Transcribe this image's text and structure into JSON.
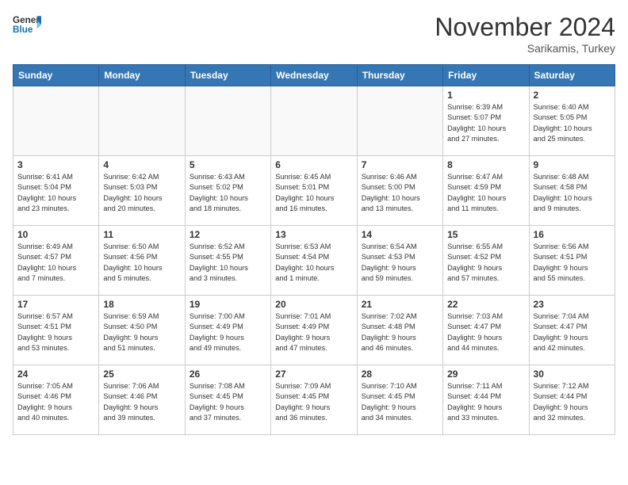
{
  "header": {
    "logo_line1": "General",
    "logo_line2": "Blue",
    "month": "November 2024",
    "location": "Sarikamis, Turkey"
  },
  "weekdays": [
    "Sunday",
    "Monday",
    "Tuesday",
    "Wednesday",
    "Thursday",
    "Friday",
    "Saturday"
  ],
  "weeks": [
    [
      {
        "day": "",
        "info": ""
      },
      {
        "day": "",
        "info": ""
      },
      {
        "day": "",
        "info": ""
      },
      {
        "day": "",
        "info": ""
      },
      {
        "day": "",
        "info": ""
      },
      {
        "day": "1",
        "info": "Sunrise: 6:39 AM\nSunset: 5:07 PM\nDaylight: 10 hours\nand 27 minutes."
      },
      {
        "day": "2",
        "info": "Sunrise: 6:40 AM\nSunset: 5:05 PM\nDaylight: 10 hours\nand 25 minutes."
      }
    ],
    [
      {
        "day": "3",
        "info": "Sunrise: 6:41 AM\nSunset: 5:04 PM\nDaylight: 10 hours\nand 23 minutes."
      },
      {
        "day": "4",
        "info": "Sunrise: 6:42 AM\nSunset: 5:03 PM\nDaylight: 10 hours\nand 20 minutes."
      },
      {
        "day": "5",
        "info": "Sunrise: 6:43 AM\nSunset: 5:02 PM\nDaylight: 10 hours\nand 18 minutes."
      },
      {
        "day": "6",
        "info": "Sunrise: 6:45 AM\nSunset: 5:01 PM\nDaylight: 10 hours\nand 16 minutes."
      },
      {
        "day": "7",
        "info": "Sunrise: 6:46 AM\nSunset: 5:00 PM\nDaylight: 10 hours\nand 13 minutes."
      },
      {
        "day": "8",
        "info": "Sunrise: 6:47 AM\nSunset: 4:59 PM\nDaylight: 10 hours\nand 11 minutes."
      },
      {
        "day": "9",
        "info": "Sunrise: 6:48 AM\nSunset: 4:58 PM\nDaylight: 10 hours\nand 9 minutes."
      }
    ],
    [
      {
        "day": "10",
        "info": "Sunrise: 6:49 AM\nSunset: 4:57 PM\nDaylight: 10 hours\nand 7 minutes."
      },
      {
        "day": "11",
        "info": "Sunrise: 6:50 AM\nSunset: 4:56 PM\nDaylight: 10 hours\nand 5 minutes."
      },
      {
        "day": "12",
        "info": "Sunrise: 6:52 AM\nSunset: 4:55 PM\nDaylight: 10 hours\nand 3 minutes."
      },
      {
        "day": "13",
        "info": "Sunrise: 6:53 AM\nSunset: 4:54 PM\nDaylight: 10 hours\nand 1 minute."
      },
      {
        "day": "14",
        "info": "Sunrise: 6:54 AM\nSunset: 4:53 PM\nDaylight: 9 hours\nand 59 minutes."
      },
      {
        "day": "15",
        "info": "Sunrise: 6:55 AM\nSunset: 4:52 PM\nDaylight: 9 hours\nand 57 minutes."
      },
      {
        "day": "16",
        "info": "Sunrise: 6:56 AM\nSunset: 4:51 PM\nDaylight: 9 hours\nand 55 minutes."
      }
    ],
    [
      {
        "day": "17",
        "info": "Sunrise: 6:57 AM\nSunset: 4:51 PM\nDaylight: 9 hours\nand 53 minutes."
      },
      {
        "day": "18",
        "info": "Sunrise: 6:59 AM\nSunset: 4:50 PM\nDaylight: 9 hours\nand 51 minutes."
      },
      {
        "day": "19",
        "info": "Sunrise: 7:00 AM\nSunset: 4:49 PM\nDaylight: 9 hours\nand 49 minutes."
      },
      {
        "day": "20",
        "info": "Sunrise: 7:01 AM\nSunset: 4:49 PM\nDaylight: 9 hours\nand 47 minutes."
      },
      {
        "day": "21",
        "info": "Sunrise: 7:02 AM\nSunset: 4:48 PM\nDaylight: 9 hours\nand 46 minutes."
      },
      {
        "day": "22",
        "info": "Sunrise: 7:03 AM\nSunset: 4:47 PM\nDaylight: 9 hours\nand 44 minutes."
      },
      {
        "day": "23",
        "info": "Sunrise: 7:04 AM\nSunset: 4:47 PM\nDaylight: 9 hours\nand 42 minutes."
      }
    ],
    [
      {
        "day": "24",
        "info": "Sunrise: 7:05 AM\nSunset: 4:46 PM\nDaylight: 9 hours\nand 40 minutes."
      },
      {
        "day": "25",
        "info": "Sunrise: 7:06 AM\nSunset: 4:46 PM\nDaylight: 9 hours\nand 39 minutes."
      },
      {
        "day": "26",
        "info": "Sunrise: 7:08 AM\nSunset: 4:45 PM\nDaylight: 9 hours\nand 37 minutes."
      },
      {
        "day": "27",
        "info": "Sunrise: 7:09 AM\nSunset: 4:45 PM\nDaylight: 9 hours\nand 36 minutes."
      },
      {
        "day": "28",
        "info": "Sunrise: 7:10 AM\nSunset: 4:45 PM\nDaylight: 9 hours\nand 34 minutes."
      },
      {
        "day": "29",
        "info": "Sunrise: 7:11 AM\nSunset: 4:44 PM\nDaylight: 9 hours\nand 33 minutes."
      },
      {
        "day": "30",
        "info": "Sunrise: 7:12 AM\nSunset: 4:44 PM\nDaylight: 9 hours\nand 32 minutes."
      }
    ]
  ]
}
